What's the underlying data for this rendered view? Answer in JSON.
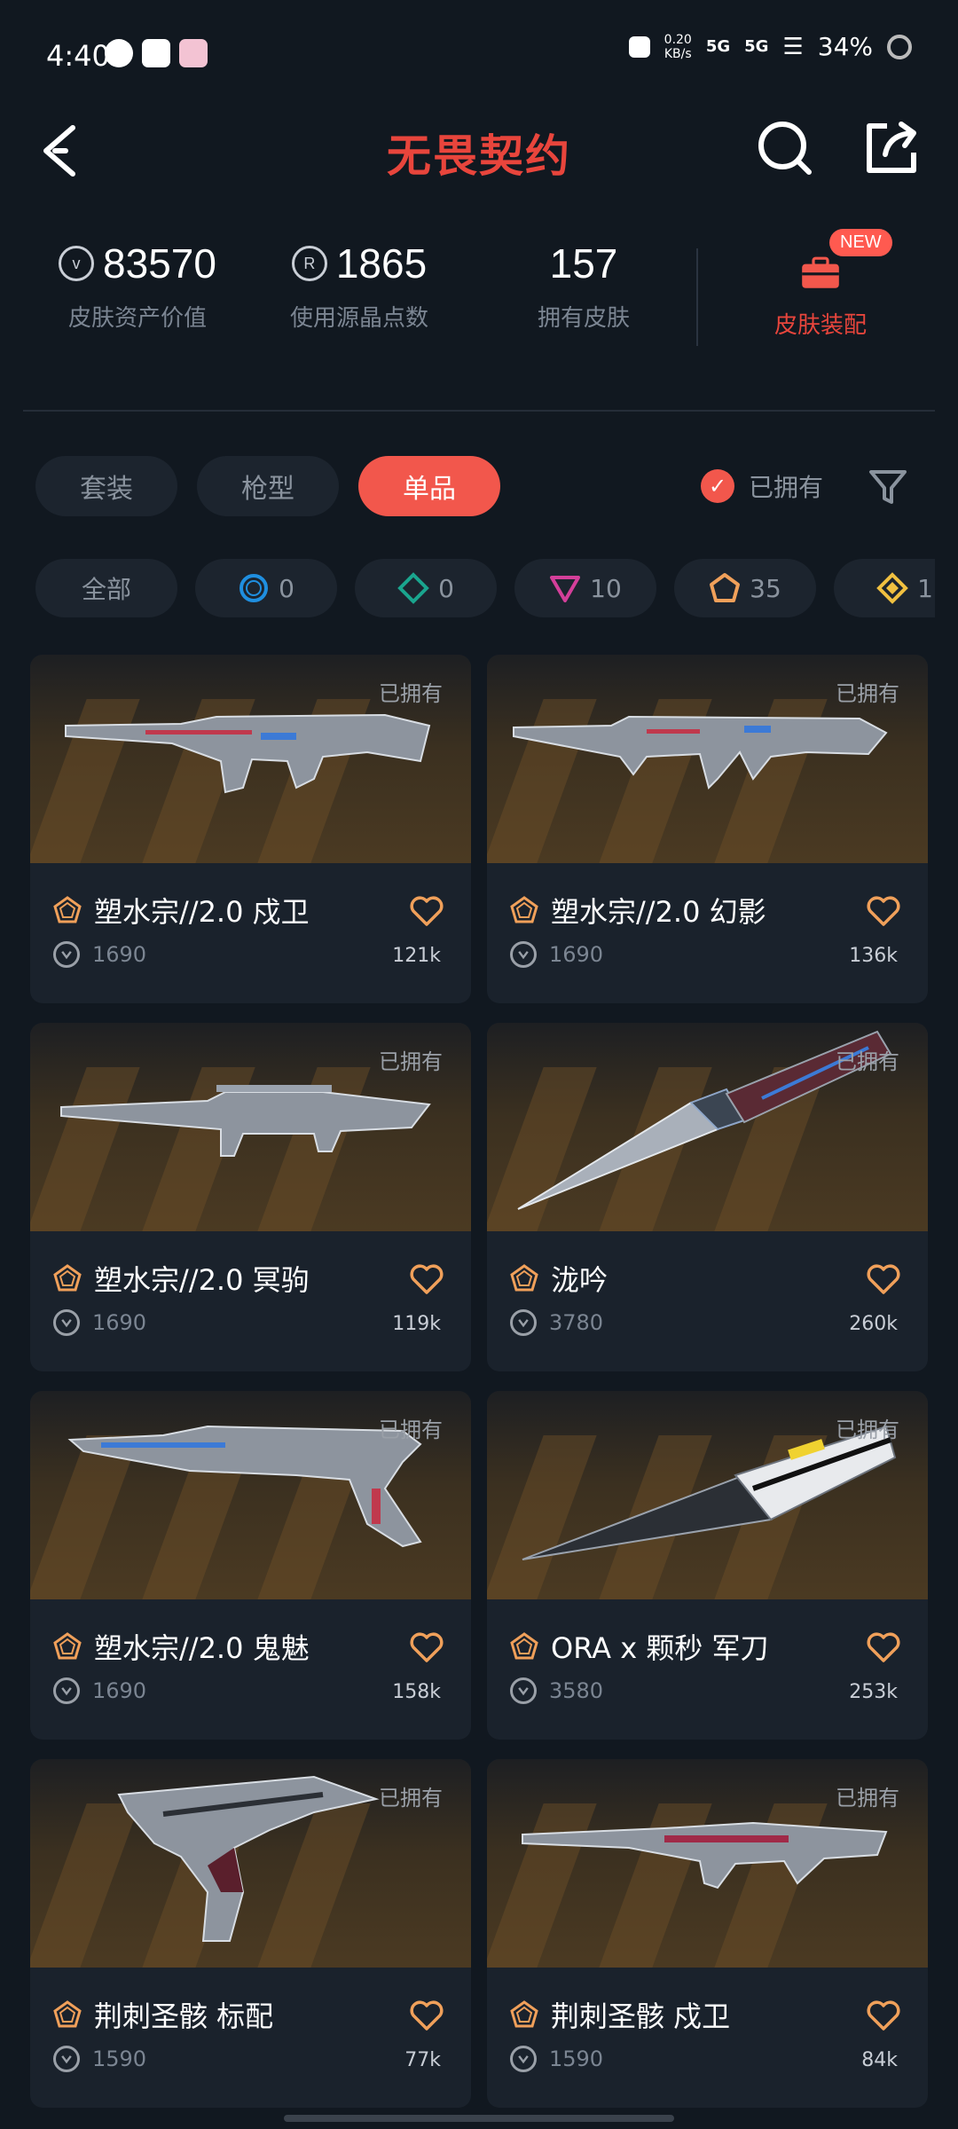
{
  "status_bar": {
    "time": "4:40",
    "speed": "0.20",
    "speed_unit": "KB/s",
    "sig1": "5G",
    "sig2": "5G",
    "battery": "34%"
  },
  "header": {
    "title": "无畏契约"
  },
  "stats": [
    {
      "value": "83570",
      "label": "皮肤资产价值",
      "icon": "vp-coin-icon"
    },
    {
      "value": "1865",
      "label": "使用源晶点数",
      "icon": "radianite-icon"
    },
    {
      "value": "157",
      "label": "拥有皮肤"
    }
  ],
  "equip": {
    "label": "皮肤装配",
    "badge": "NEW"
  },
  "tabs": [
    {
      "label": "套装",
      "active": false
    },
    {
      "label": "枪型",
      "active": false
    },
    {
      "label": "单品",
      "active": true
    }
  ],
  "owned_filter": {
    "label": "已拥有",
    "checked": true
  },
  "rarities": [
    {
      "label": "全部"
    },
    {
      "count": "0",
      "color": "#1f8fe0",
      "icon": "select-tier-icon"
    },
    {
      "count": "0",
      "color": "#1aa58e",
      "icon": "deluxe-tier-icon"
    },
    {
      "count": "10",
      "color": "#d43f9a",
      "icon": "premium-tier-icon"
    },
    {
      "count": "35",
      "color": "#f0a05a",
      "icon": "exclusive-tier-icon"
    },
    {
      "count": "1",
      "color": "#f0c040",
      "icon": "ultra-tier-icon"
    }
  ],
  "owned_tag": "已拥有",
  "items": [
    {
      "name": "塑水宗//2.0 戍卫",
      "price": "1690",
      "likes": "121k",
      "weapon": "rifle"
    },
    {
      "name": "塑水宗//2.0 幻影",
      "price": "1690",
      "likes": "136k",
      "weapon": "rifle2"
    },
    {
      "name": "塑水宗//2.0 冥驹",
      "price": "1690",
      "likes": "119k",
      "weapon": "sniper"
    },
    {
      "name": "泷吟",
      "price": "3780",
      "likes": "260k",
      "weapon": "knife"
    },
    {
      "name": "塑水宗//2.0 鬼魅",
      "price": "1690",
      "likes": "158k",
      "weapon": "pistol"
    },
    {
      "name": "ORA x 颗秒 军刀",
      "price": "3580",
      "likes": "253k",
      "weapon": "blade"
    },
    {
      "name": "荆刺圣骸 标配",
      "price": "1590",
      "likes": "77k",
      "weapon": "classic"
    },
    {
      "name": "荆刺圣骸 戍卫",
      "price": "1590",
      "likes": "84k",
      "weapon": "rifle3"
    }
  ]
}
